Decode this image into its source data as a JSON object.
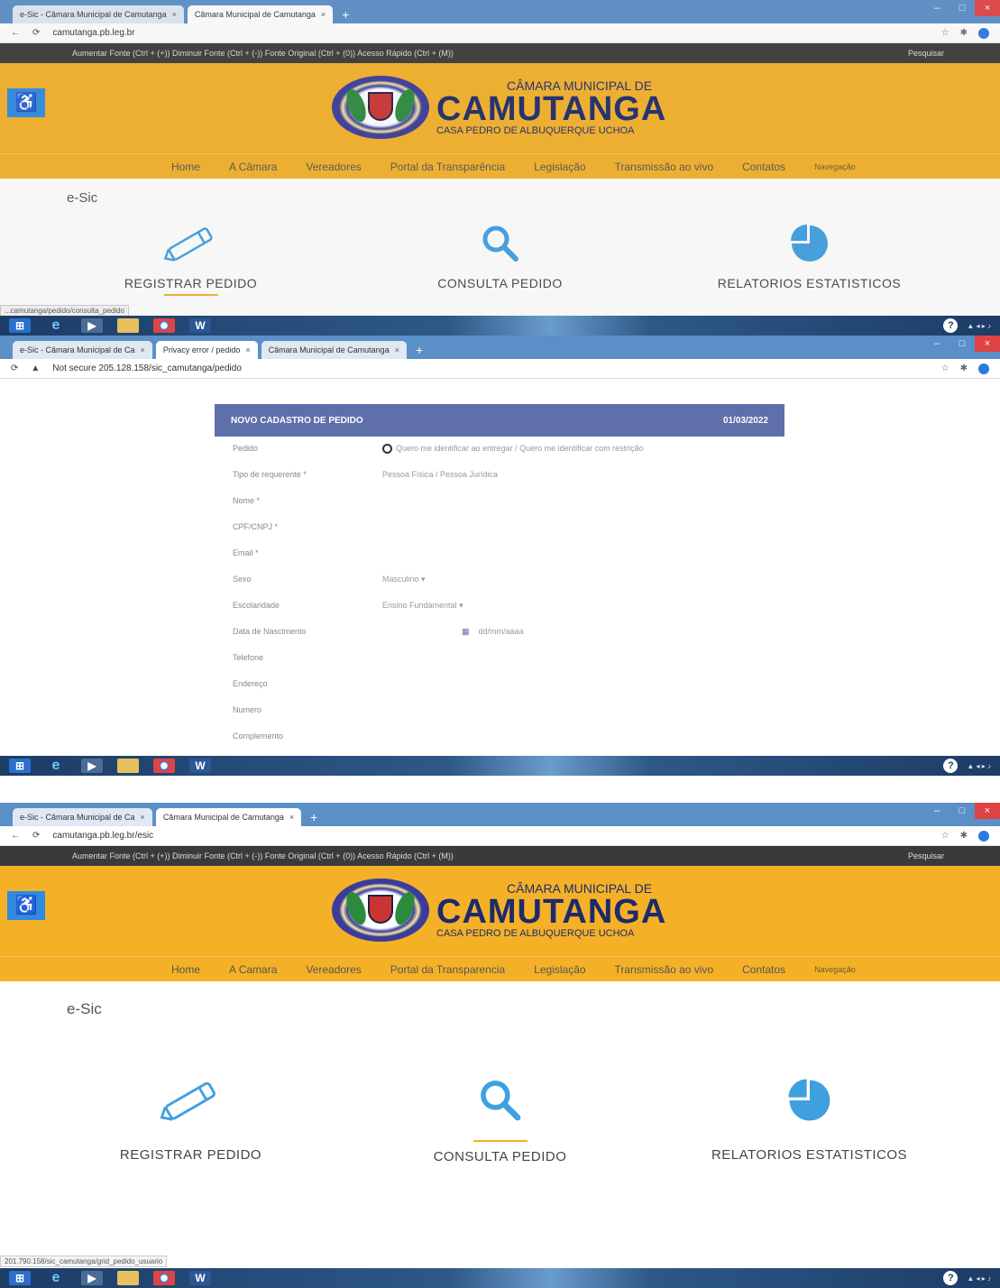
{
  "shot1": {
    "tabs": [
      "e-Sic - Câmara Municipal de Camutanga",
      "Câmara Municipal de Camutanga"
    ],
    "url": "camutanga.pb.leg.br",
    "acc_bar": "Aumentar Fonte (Ctrl + (+)) Diminuir Fonte (Ctrl + (-)) Fonte Original (Ctrl + (0)) Acesso Rápido (Ctrl + (M))",
    "acc_right": "Pesquisar",
    "brand": {
      "l1": "CÂMARA MUNICIPAL DE",
      "l2": "CAMUTANGA",
      "l3": "CASA PEDRO DE ALBUQUERQUE UCHOA"
    },
    "nav": [
      "Home",
      "A Câmara",
      "Vereadores",
      "Portal da Transparência",
      "Legislação",
      "Transmissão ao vivo",
      "Contatos",
      "Navegação"
    ],
    "section": "e-Sic",
    "cards": [
      "REGISTRAR PEDIDO",
      "CONSULTA PEDIDO",
      "RELATORIOS ESTATISTICOS"
    ],
    "status_url": "...camutanga/pedido/consulta_pedido"
  },
  "shot2": {
    "tabs": [
      "e-Sic - Câmara Municipal de Ca",
      "Privacy error / pedido",
      "Câmara Municipal de Camutanga"
    ],
    "url": "Not secure  205.128.158/sic_camutanga/pedido",
    "form_title": "NOVO CADASTRO DE PEDIDO",
    "form_date": "01/03/2022",
    "rows": [
      {
        "label": "Pedido",
        "value": "Quero me identificar ao entregar / Quero me identificar com restrição"
      },
      {
        "label": "Tipo de requerente *",
        "value": "Pessoa Física / Pessoa Jurídica"
      },
      {
        "label": "Nome *",
        "value": ""
      },
      {
        "label": "CPF/CNPJ *",
        "value": ""
      },
      {
        "label": "Email *",
        "value": ""
      },
      {
        "label": "Sexo",
        "value": "Masculino"
      },
      {
        "label": "Escolaridade",
        "value": "Ensino Fundamental"
      },
      {
        "label": "Data de Nascimento",
        "value": "dd/mm/aaaa"
      },
      {
        "label": "Telefone",
        "value": ""
      },
      {
        "label": "Endereço",
        "value": ""
      },
      {
        "label": "Numero",
        "value": ""
      },
      {
        "label": "Complemento",
        "value": ""
      }
    ]
  },
  "shot3": {
    "tabs": [
      "e-Sic - Câmara Municipal de Ca",
      "Câmara Municipal de Camutanga"
    ],
    "url": "camutanga.pb.leg.br/esic",
    "acc_bar": "Aumentar Fonte (Ctrl + (+)) Diminuir Fonte (Ctrl + (-)) Fonte Original (Ctrl + (0)) Acesso Rápido (Ctrl + (M))",
    "acc_right": "Pesquisar",
    "brand": {
      "l1": "CÂMARA MUNICIPAL DE",
      "l2": "CAMUTANGA",
      "l3": "CASA PEDRO DE ALBUQUERQUE UCHOA"
    },
    "nav": [
      "Home",
      "A Camara",
      "Vereadores",
      "Portal da Transparencia",
      "Legislação",
      "Transmissão ao vivo",
      "Contatos",
      "Navegação"
    ],
    "section": "e-Sic",
    "cards": [
      "REGISTRAR PEDIDO",
      "CONSULTA PEDIDO",
      "RELATORIOS ESTATISTICOS"
    ],
    "status_url": "201.790.158/sic_camutanga/grid_pedido_usuario"
  },
  "colors": {
    "header": "#f4b128",
    "brand": "#1d2a6b",
    "accent": "#2f8ae0",
    "form_header": "#5e6faa"
  },
  "icons": [
    "accessibility-icon",
    "pencil-icon",
    "search-icon",
    "pie-chart-icon",
    "windows-start-icon",
    "ie-icon",
    "folder-icon",
    "chrome-icon",
    "word-icon",
    "help-icon"
  ]
}
